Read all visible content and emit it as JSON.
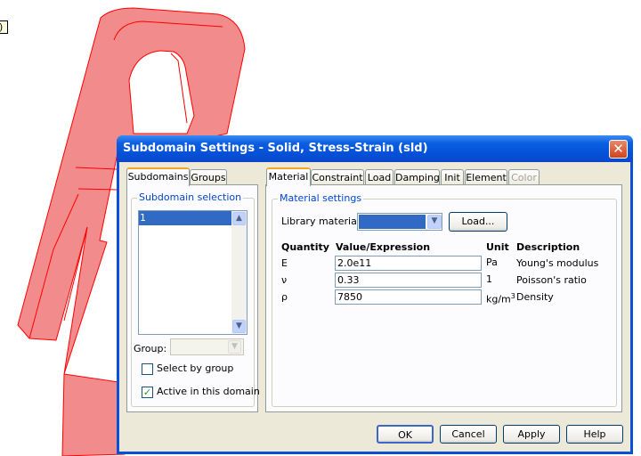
{
  "tooltip": ")",
  "dialog": {
    "title": "Subdomain Settings - Solid, Stress-Strain (sld)",
    "close_icon": "close-icon",
    "left_tabs": [
      {
        "label": "Subdomains",
        "selected": true
      },
      {
        "label": "Groups",
        "selected": false
      }
    ],
    "subdomain_selection": {
      "label": "Subdomain selection",
      "items": [
        "1"
      ],
      "selected": "1"
    },
    "group": {
      "label": "Group:",
      "value": ""
    },
    "select_by_group": {
      "label": "Select by group",
      "checked": false
    },
    "active_in_domain": {
      "label": "Active in this domain",
      "checked": true
    },
    "right_tabs": [
      {
        "label": "Material",
        "selected": true
      },
      {
        "label": "Constraint"
      },
      {
        "label": "Load"
      },
      {
        "label": "Damping"
      },
      {
        "label": "Init"
      },
      {
        "label": "Element"
      },
      {
        "label": "Color",
        "disabled": true
      }
    ],
    "material_settings": {
      "label": "Material settings",
      "library_label": "Library material:",
      "library_value": "",
      "load_button": "Load...",
      "headers": {
        "quantity": "Quantity",
        "value": "Value/Expression",
        "unit": "Unit",
        "description": "Description"
      },
      "rows": [
        {
          "quantity": "E",
          "value": "2.0e11",
          "unit": "Pa",
          "unit_sup": "",
          "description": "Young's modulus"
        },
        {
          "quantity": "ν",
          "value": "0.33",
          "unit": "1",
          "unit_sup": "",
          "description": "Poisson's ratio"
        },
        {
          "quantity": "ρ",
          "value": "7850",
          "unit": "kg/m",
          "unit_sup": "3",
          "description": "Density"
        }
      ]
    },
    "buttons": {
      "ok": "OK",
      "cancel": "Cancel",
      "apply": "Apply",
      "help": "Help"
    }
  },
  "colors": {
    "geometry_fill": "#f28b8b",
    "geometry_edge": "#ff0000",
    "selection": "#316ac5",
    "title_bar": "#0a5ee0"
  }
}
